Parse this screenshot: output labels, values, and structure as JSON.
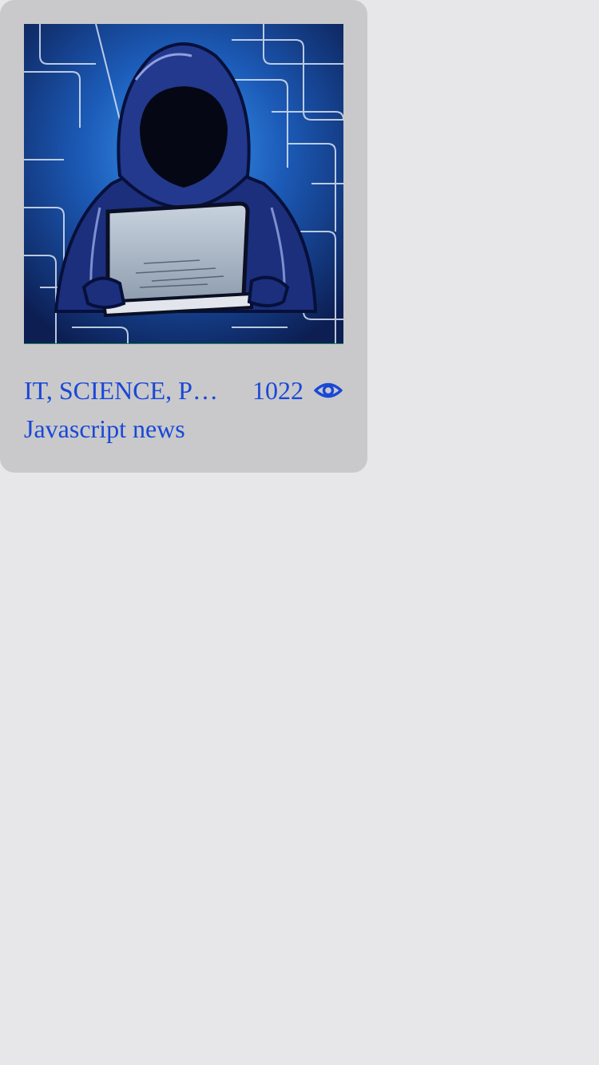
{
  "card": {
    "category": "IT, SCIENCE, PROGRAMMING",
    "views": "1022",
    "title": "Javascript news",
    "thumbnail": "hooded-hacker-laptop-illustration",
    "views_icon": "eye-icon"
  },
  "colors": {
    "page_background": "#e7e7e9",
    "card_background": "#c9c9cb",
    "text_accent": "#1948d6",
    "art_blue": "#1c5bb8",
    "art_dark_navy": "#0c1e52"
  }
}
